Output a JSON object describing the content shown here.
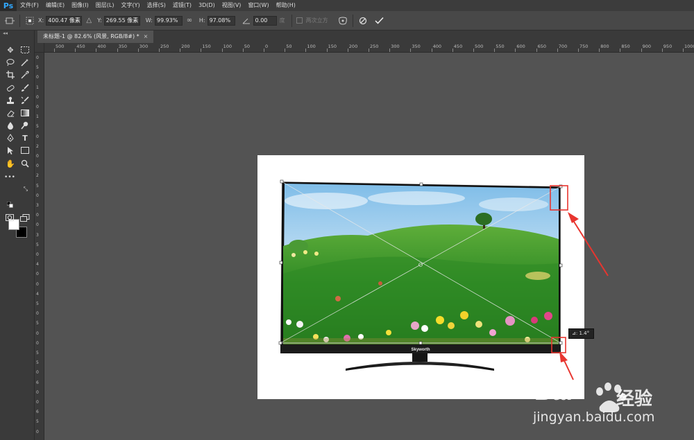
{
  "app": {
    "logo": "Ps",
    "menu": [
      "文件(F)",
      "编辑(E)",
      "图像(I)",
      "图层(L)",
      "文字(Y)",
      "选择(S)",
      "滤镜(T)",
      "3D(D)",
      "视图(V)",
      "窗口(W)",
      "帮助(H)"
    ]
  },
  "options": {
    "x_label": "X:",
    "x_value": "400.47 像素",
    "y_label": "Y:",
    "y_value": "269.55 像素",
    "w_label": "W:",
    "w_value": "99.93%",
    "h_label": "H:",
    "h_value": "97.08%",
    "angle_value": "0.00",
    "angle_unit": "度",
    "interp_label": "两次立方",
    "icons": [
      "reference-point-icon",
      "delta-icon",
      "link-icon",
      "angle-icon",
      "warp-icon",
      "cancel-icon",
      "commit-icon"
    ]
  },
  "document": {
    "tab_title": "未标题-1 @ 82.6% (风景, RGB/8#) *",
    "tab_close": "×"
  },
  "rulers": {
    "top": [
      "500",
      "450",
      "400",
      "350",
      "300",
      "250",
      "200",
      "150",
      "100",
      "50",
      "0",
      "50",
      "100",
      "150",
      "200",
      "250",
      "300",
      "350",
      "400",
      "450",
      "500",
      "550",
      "600",
      "650",
      "700",
      "750",
      "800",
      "850",
      "900",
      "950",
      "1000"
    ],
    "left": [
      "0",
      "5",
      "0",
      "1",
      "0",
      "0",
      "1",
      "5",
      "0",
      "2",
      "0",
      "0",
      "2",
      "5",
      "0",
      "3",
      "0",
      "0",
      "3",
      "5",
      "0",
      "4",
      "0",
      "0",
      "4",
      "5",
      "0",
      "5",
      "0",
      "0",
      "5",
      "5",
      "0",
      "6",
      "0",
      "0",
      "6",
      "5",
      "0"
    ]
  },
  "canvas": {
    "tv_brand": "Skyworth",
    "angle_readout": "⊿: 1.4°"
  },
  "annotation_color": "#e8352f",
  "watermark": {
    "brand": "Bai",
    "brand_cn": "经验",
    "url": "jingyan.baidu.com"
  }
}
